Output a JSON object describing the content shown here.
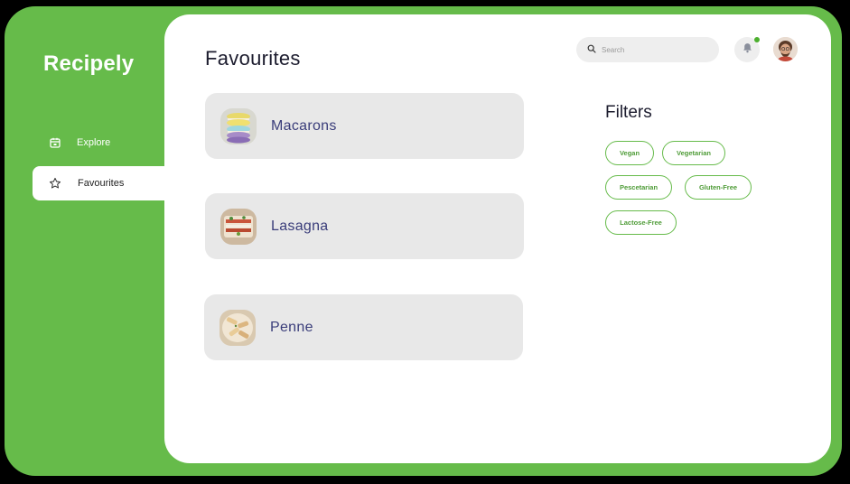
{
  "app": {
    "brand": "Recipely",
    "accent_color": "#66bb4a"
  },
  "sidebar": {
    "items": [
      {
        "label": "Explore",
        "icon": "calendar-icon",
        "active": false
      },
      {
        "label": "Favourites",
        "icon": "star-icon",
        "active": true
      }
    ]
  },
  "header": {
    "title": "Favourites",
    "search": {
      "placeholder": "Search",
      "value": ""
    },
    "notification_icon": "bell-icon",
    "has_notification": true
  },
  "favourites": [
    {
      "name": "Macarons"
    },
    {
      "name": "Lasagna"
    },
    {
      "name": "Penne"
    }
  ],
  "filters": {
    "title": "Filters",
    "chips": [
      "Vegan",
      "Vegetarian",
      "Pescetarian",
      "Gluten-Free",
      "Lactose-Free"
    ]
  }
}
